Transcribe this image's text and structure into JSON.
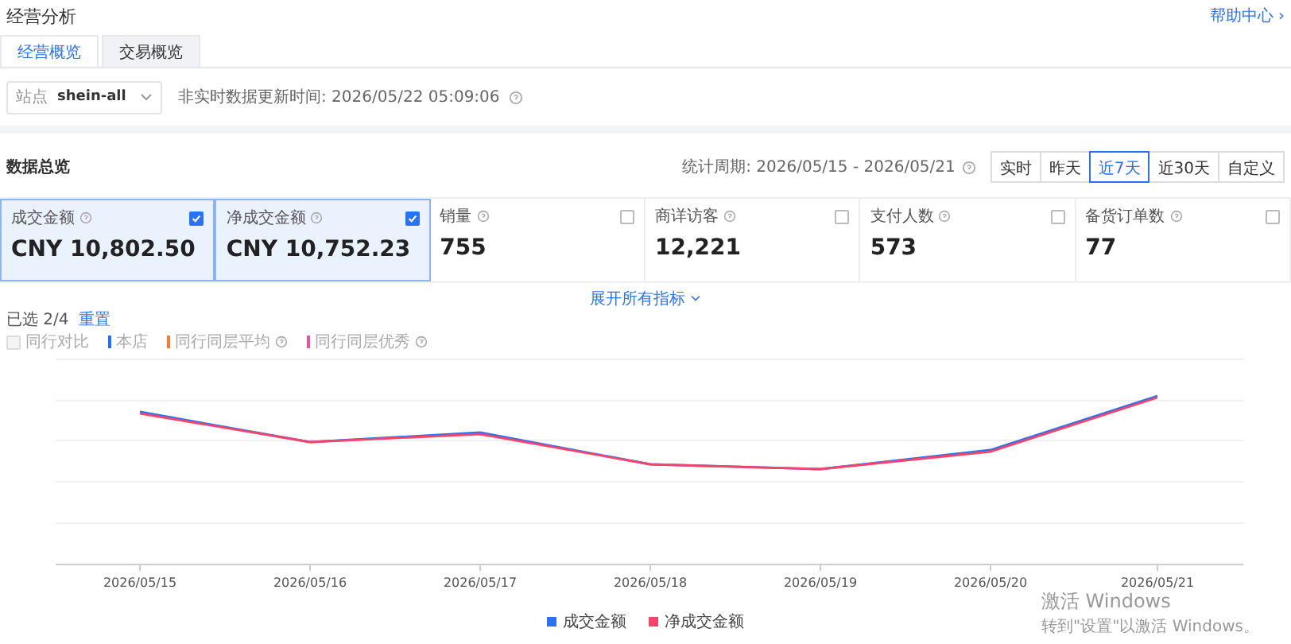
{
  "page_title": "经营分析",
  "help_link": "帮助中心 ›",
  "tabs": [
    {
      "label": "经营概览",
      "selected": true
    },
    {
      "label": "交易概览",
      "selected": false
    }
  ],
  "site_filter": {
    "label": "站点",
    "value": "shein-all"
  },
  "update_time": "非实时数据更新时间: 2026/05/22 05:09:06",
  "section_title": "数据总览",
  "period": "统计周期: 2026/05/15 - 2026/05/21",
  "ranges": [
    {
      "label": "实时",
      "selected": false
    },
    {
      "label": "昨天",
      "selected": false
    },
    {
      "label": "近7天",
      "selected": true
    },
    {
      "label": "近30天",
      "selected": false
    },
    {
      "label": "自定义",
      "selected": false
    }
  ],
  "metrics": [
    {
      "label": "成交金额",
      "value": "CNY 10,802.50",
      "checked": true
    },
    {
      "label": "净成交金额",
      "value": "CNY 10,752.23",
      "checked": true
    },
    {
      "label": "销量",
      "value": "755",
      "checked": false
    },
    {
      "label": "商详访客",
      "value": "12,221",
      "checked": false
    },
    {
      "label": "支付人数",
      "value": "573",
      "checked": false
    },
    {
      "label": "备货订单数",
      "value": "77",
      "checked": false
    }
  ],
  "expand_link": "展开所有指标",
  "selected_count": "已选 2/4",
  "reset_link": "重置",
  "compare": {
    "label": "同行对比",
    "checked": false,
    "disabled": true
  },
  "compare_legend": [
    {
      "label": "本店",
      "color": "#1f6fff",
      "info": false
    },
    {
      "label": "同行同层平均",
      "color": "#ff7a2e",
      "info": true
    },
    {
      "label": "同行同层优秀",
      "color": "#e8559a",
      "info": true
    }
  ],
  "x_labels": [
    "2026/05/15",
    "2026/05/16",
    "2026/05/17",
    "2026/05/18",
    "2026/05/19",
    "2026/05/20",
    "2026/05/21"
  ],
  "legend": [
    {
      "label": "成交金额",
      "color": "#2a72f5"
    },
    {
      "label": "净成交金额",
      "color": "#f5456a"
    }
  ],
  "os_notice": {
    "title": "激活 Windows",
    "text": "转到\"设置\"以激活 Windows。"
  }
}
